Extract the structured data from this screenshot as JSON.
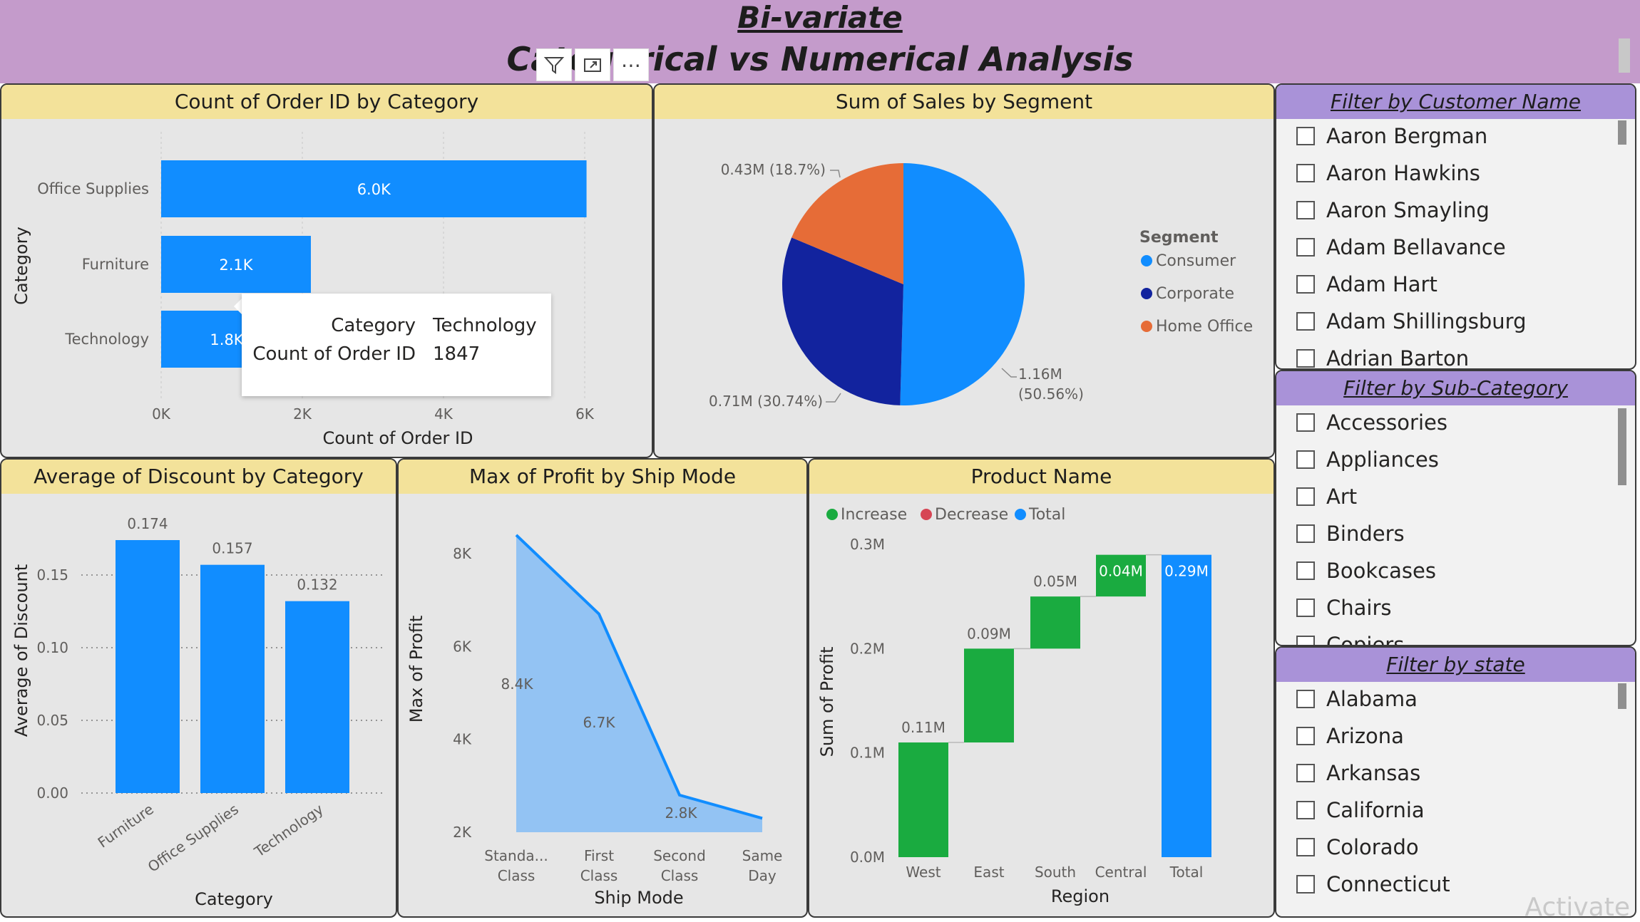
{
  "header": {
    "title_line1": "Bi-variate",
    "title_line2": "Categorical vs Numerical Analysis",
    "toolbar": [
      {
        "name": "filter-icon",
        "glyph": "⛉"
      },
      {
        "name": "focus-mode-icon",
        "glyph": "⤢"
      },
      {
        "name": "more-options-icon",
        "glyph": "⋯"
      }
    ]
  },
  "panels": {
    "order_count": {
      "title": "Count of Order ID by Category",
      "chart_data": {
        "type": "bar",
        "orientation": "horizontal",
        "categories": [
          "Office Supplies",
          "Furniture",
          "Technology"
        ],
        "values": [
          6026,
          2121,
          1847
        ],
        "data_labels": [
          "6.0K",
          "2.1K",
          "1.8K"
        ],
        "xlabel": "Count of Order ID",
        "ylabel": "Category",
        "xlim": [
          0,
          6000
        ],
        "xticks": [
          0,
          2000,
          4000,
          6000
        ],
        "xtick_labels": [
          "0K",
          "2K",
          "4K",
          "6K"
        ],
        "grid": true,
        "color": "#118dff"
      },
      "tooltip": {
        "rows": [
          {
            "key": "Category",
            "value": "Technology"
          },
          {
            "key": "Count of Order ID",
            "value": "1847"
          }
        ]
      }
    },
    "sales_segment": {
      "title": "Sum of Sales by Segment",
      "chart_data": {
        "type": "pie",
        "categories": [
          "Consumer",
          "Corporate",
          "Home Office"
        ],
        "values": [
          1.16,
          0.71,
          0.43
        ],
        "percentages": [
          50.56,
          30.74,
          18.7
        ],
        "colors": [
          "#118dff",
          "#12239e",
          "#e66c37"
        ],
        "data_labels": [
          "1.16M",
          "(50.56%)",
          "0.71M (30.74%)",
          "0.43M (18.7%)"
        ],
        "legend_title": "Segment",
        "legend_placement": "right"
      }
    },
    "discount": {
      "title": "Average of Discount by Category",
      "chart_data": {
        "type": "bar",
        "categories": [
          "Furniture",
          "Office Supplies",
          "Technology"
        ],
        "values": [
          0.174,
          0.157,
          0.132
        ],
        "data_labels": [
          "0.174",
          "0.157",
          "0.132"
        ],
        "xlabel": "Category",
        "ylabel": "Average of Discount",
        "ylim": [
          0,
          0.174
        ],
        "yticks": [
          0,
          0.05,
          0.1,
          0.15
        ],
        "ytick_labels": [
          "0.00",
          "0.05",
          "0.10",
          "0.15"
        ],
        "grid": true,
        "color": "#118dff"
      }
    },
    "profit_ship": {
      "title": "Max of Profit by Ship Mode",
      "chart_data": {
        "type": "area",
        "categories": [
          "Standa... Class",
          "First Class",
          "Second Class",
          "Same Day"
        ],
        "category_lines": [
          [
            "Standa...",
            "Class"
          ],
          [
            "First",
            "Class"
          ],
          [
            "Second",
            "Class"
          ],
          [
            "Same",
            "Day"
          ]
        ],
        "values": [
          8400,
          6700,
          2800,
          2300
        ],
        "data_labels": [
          "8.4K",
          "6.7K",
          "2.8K",
          ""
        ],
        "xlabel": "Ship Mode",
        "ylabel": "Max of Profit",
        "ylim": [
          2000,
          8400
        ],
        "yticks": [
          2000,
          4000,
          6000,
          8000
        ],
        "ytick_labels": [
          "2K",
          "4K",
          "6K",
          "8K"
        ],
        "line_color": "#118dff",
        "fill_color": "#93c3f3"
      }
    },
    "waterfall": {
      "title": "Product Name",
      "chart_data": {
        "type": "waterfall",
        "categories": [
          "West",
          "East",
          "South",
          "Central",
          "Total"
        ],
        "values": [
          0.11,
          0.09,
          0.05,
          0.04,
          0.29
        ],
        "is_total": [
          false,
          false,
          false,
          false,
          true
        ],
        "data_labels": [
          "0.11M",
          "0.09M",
          "0.05M",
          "0.04M",
          "0.29M"
        ],
        "xlabel": "Region",
        "ylabel": "Sum of Profit",
        "ylim": [
          0,
          0.3
        ],
        "yticks": [
          0,
          0.1,
          0.2,
          0.3
        ],
        "ytick_labels": [
          "0.0M",
          "0.1M",
          "0.2M",
          "0.3M"
        ],
        "legend": [
          {
            "label": "Increase",
            "color": "#1aab40"
          },
          {
            "label": "Decrease",
            "color": "#d64554"
          },
          {
            "label": "Total",
            "color": "#118dff"
          }
        ],
        "legend_placement": "top-left"
      }
    }
  },
  "slicers": [
    {
      "title": "Filter by Customer Name",
      "items": [
        "Aaron Bergman",
        "Aaron Hawkins",
        "Aaron Smayling",
        "Adam Bellavance",
        "Adam Hart",
        "Adam Shillingsburg",
        "Adrian Barton"
      ]
    },
    {
      "title": "Filter by Sub-Category",
      "items": [
        "Accessories",
        "Appliances",
        "Art",
        "Binders",
        "Bookcases",
        "Chairs",
        "Copiers"
      ]
    },
    {
      "title": "Filter by state",
      "items": [
        "Alabama",
        "Arizona",
        "Arkansas",
        "California",
        "Colorado",
        "Connecticut"
      ]
    }
  ],
  "watermark": "Activate"
}
